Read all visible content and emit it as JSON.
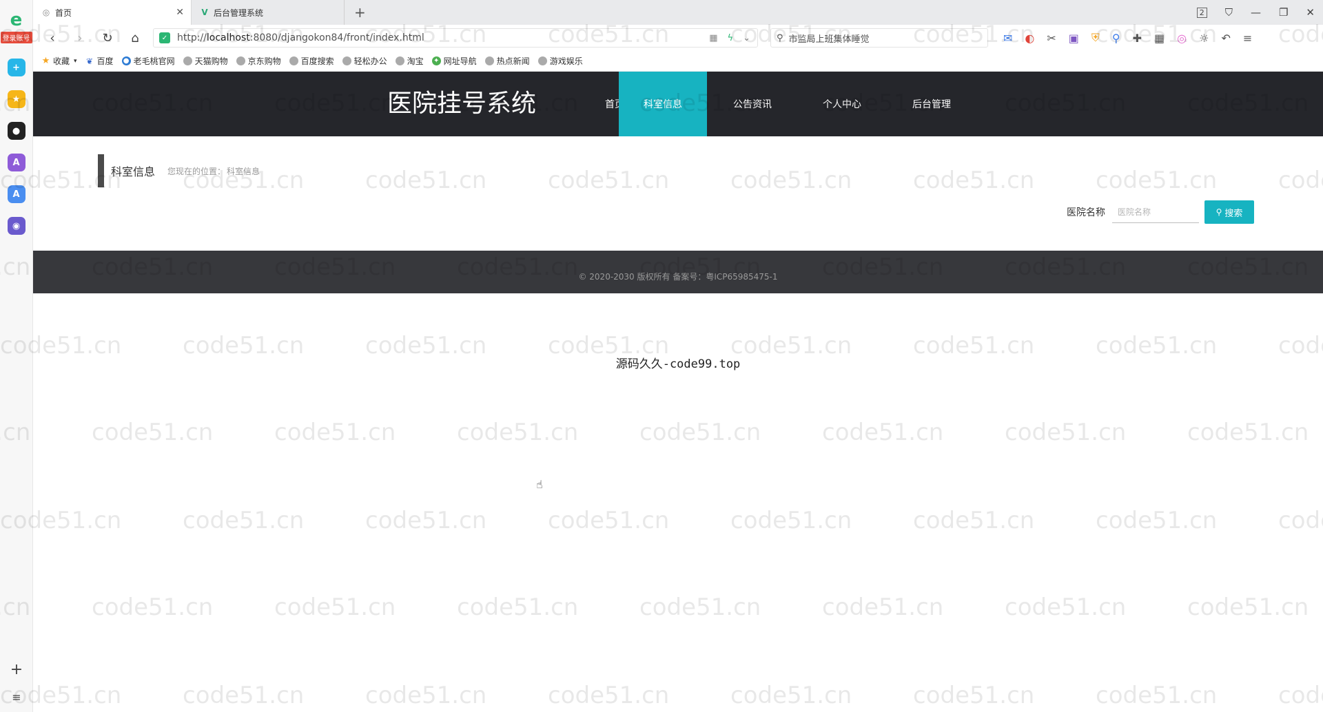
{
  "browser": {
    "sidebar": {
      "login_badge": "登录账号"
    },
    "tabs": [
      {
        "title": "首页",
        "active": true
      },
      {
        "title": "后台管理系统",
        "active": false
      }
    ],
    "address": {
      "url_prefix": "http://",
      "url_host": "localhost",
      "url_rest": ":8080/djangokon84/front/index.html"
    },
    "search": {
      "text": "市监局上班集体睡觉"
    },
    "tab_count": "2",
    "bookmarks": [
      {
        "label": "收藏",
        "icon": "star-icon",
        "color": "#f5a623"
      },
      {
        "label": "百度",
        "icon": "baidu-icon",
        "color": "#3366cc"
      },
      {
        "label": "老毛桃官网",
        "icon": "globe-icon",
        "color": "#2d7bd4"
      },
      {
        "label": "天猫购物",
        "icon": "globe-icon",
        "color": "#999999"
      },
      {
        "label": "京东购物",
        "icon": "globe-icon",
        "color": "#999999"
      },
      {
        "label": "百度搜索",
        "icon": "globe-icon",
        "color": "#999999"
      },
      {
        "label": "轻松办公",
        "icon": "globe-icon",
        "color": "#999999"
      },
      {
        "label": "淘宝",
        "icon": "globe-icon",
        "color": "#999999"
      },
      {
        "label": "网址导航",
        "icon": "compass-icon",
        "color": "#4caf50"
      },
      {
        "label": "热点新闻",
        "icon": "globe-icon",
        "color": "#999999"
      },
      {
        "label": "游戏娱乐",
        "icon": "globe-icon",
        "color": "#999999"
      }
    ]
  },
  "site": {
    "title": "医院挂号系统",
    "accent": "#17b3c1",
    "nav": [
      {
        "label": "首页",
        "active": false
      },
      {
        "label": "科室信息",
        "active": true
      },
      {
        "label": "公告资讯",
        "active": false
      },
      {
        "label": "个人中心",
        "active": false
      },
      {
        "label": "后台管理",
        "active": false
      }
    ],
    "section": {
      "title": "科室信息",
      "breadcrumb_label": "您现在的位置：",
      "breadcrumb_current": "科室信息"
    },
    "search": {
      "label": "医院名称",
      "placeholder": "医院名称",
      "button": "搜索"
    },
    "footer": "© 2020-2030 版权所有 备案号：粤ICP65985475-1",
    "source_text": "源码久久-code99.top"
  },
  "watermark_text": "code51.cn"
}
